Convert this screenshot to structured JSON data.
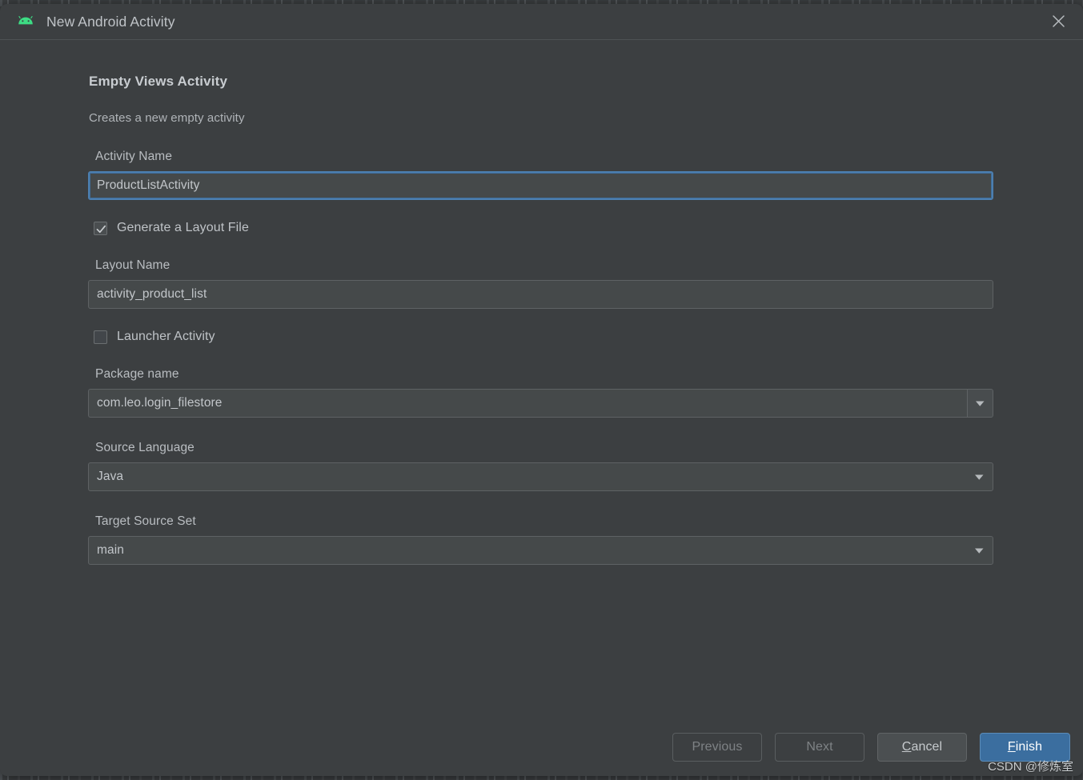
{
  "window": {
    "title": "New Android Activity",
    "icon": "android-robot-icon",
    "close_icon": "close-icon",
    "accent_blue": "#4c7fb0",
    "primary_button_color": "#3b6e9f",
    "background": "#3c3f41",
    "android_green": "#3ddc84"
  },
  "header": {
    "title": "Empty Views Activity",
    "subtitle": "Creates a new empty activity"
  },
  "form": {
    "activity_name": {
      "label": "Activity Name",
      "value": "ProductListActivity",
      "focused": true
    },
    "generate_layout": {
      "label": "Generate a Layout File",
      "checked": true
    },
    "layout_name": {
      "label": "Layout Name",
      "value": "activity_product_list"
    },
    "launcher_activity": {
      "label": "Launcher Activity",
      "checked": false
    },
    "package_name": {
      "label": "Package name",
      "value": "com.leo.login_filestore",
      "arrow_icon": "chevron-down-icon"
    },
    "source_language": {
      "label": "Source Language",
      "value": "Java",
      "arrow_icon": "chevron-down-icon"
    },
    "target_source_set": {
      "label": "Target Source Set",
      "value": "main",
      "arrow_icon": "chevron-down-icon"
    }
  },
  "footer": {
    "previous": "Previous",
    "next": "Next",
    "cancel_mnemonic": "C",
    "cancel_rest": "ancel",
    "finish_mnemonic": "F",
    "finish_rest": "inish"
  },
  "watermark": "CSDN @修炼室"
}
